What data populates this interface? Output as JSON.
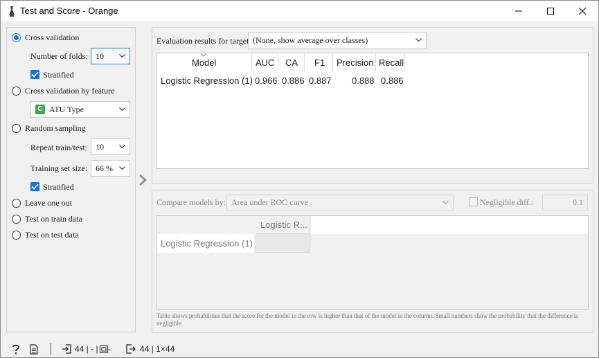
{
  "window": {
    "title": "Test and Score - Orange"
  },
  "sampling": {
    "cross_validation": "Cross validation",
    "folds_label": "Number of folds:",
    "folds_value": "10",
    "stratified1": "Stratified",
    "cv_by_feature": "Cross validation by feature",
    "feature_value": "ATU Type",
    "feature_icon_letter": "C",
    "random_sampling": "Random sampling",
    "repeat_label": "Repeat train/test:",
    "repeat_value": "10",
    "train_size_label": "Training set size:",
    "train_size_value": "66 %",
    "stratified2": "Stratified",
    "leave_one_out": "Leave one out",
    "test_on_train": "Test on train data",
    "test_on_test": "Test on test data"
  },
  "evaluation": {
    "target_label": "Evaluation results for target",
    "target_value": "(None, show average over classes)",
    "headers": [
      "Model",
      "AUC",
      "CA",
      "F1",
      "Precision",
      "Recall"
    ],
    "rows": [
      {
        "model": "Logistic Regression (1)",
        "auc": "0.966",
        "ca": "0.886",
        "f1": "0.887",
        "precision": "0.888",
        "recall": "0.886"
      }
    ]
  },
  "compare": {
    "label": "Compare models by:",
    "value": "Area under ROC curve",
    "negligible_label": "Negligible diff.:",
    "negligible_value": "0.1",
    "col_header": "Logistic R...",
    "row_header": "Logistic Regression (1)",
    "note": "Table shows probabilities that the score for the model in the row is higher than that of the model in the column. Small numbers show the probability that the difference is negligible."
  },
  "statusbar": {
    "input_text": "44 | - | ",
    "input_text2": " -",
    "output_text": "44 | 1×44"
  },
  "colors": {
    "accent": "#1e6fd9",
    "feature_icon": "#3aa84b"
  }
}
